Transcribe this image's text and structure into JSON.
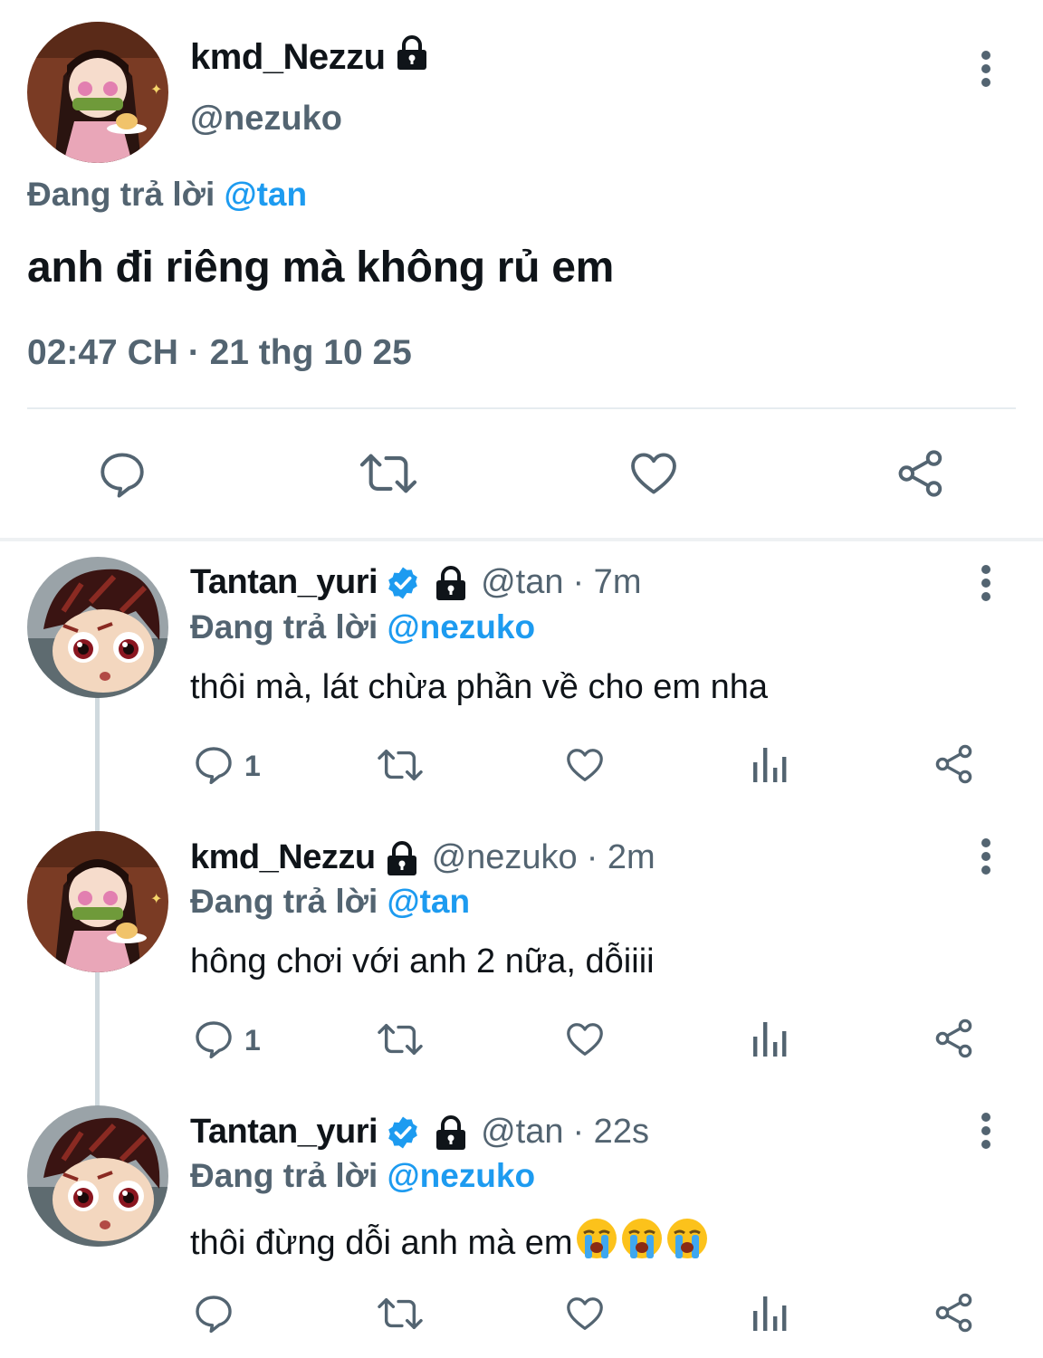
{
  "main_tweet": {
    "name": "kmd_Nezzu",
    "handle": "@nezuko",
    "replying_prefix": "Đang trả lời ",
    "replying_to": "@tan",
    "text": "anh đi riêng mà không rủ em",
    "timestamp": "02:47 CH · 21 thg 10 25"
  },
  "replies": [
    {
      "name": "Tantan_yuri",
      "handle": "@tan",
      "age": "· 7m",
      "replying_prefix": "Đang trả lời ",
      "replying_to": "@nezuko",
      "text": "thôi mà, lát chừa phần về cho em nha",
      "reply_count": "1"
    },
    {
      "name": "kmd_Nezzu",
      "handle": "@nezuko",
      "age": "· 2m",
      "replying_prefix": "Đang trả lời ",
      "replying_to": "@tan",
      "text": "hông chơi với anh 2 nữa, dỗiiii",
      "reply_count": "1"
    },
    {
      "name": "Tantan_yuri",
      "handle": "@tan",
      "age": "· 22s",
      "replying_prefix": "Đang trả lời ",
      "replying_to": "@nezuko",
      "text": "thôi đừng dỗi anh mà em",
      "reply_count": ""
    }
  ],
  "colors": {
    "text": "#0f1419",
    "secondary": "#536471",
    "accent": "#1d9bf0"
  },
  "icons": [
    "lock-icon",
    "verified-badge-icon",
    "more-options-icon",
    "reply-icon",
    "retweet-icon",
    "like-icon",
    "analytics-icon",
    "share-icon",
    "loudly-crying-face-emoji"
  ]
}
